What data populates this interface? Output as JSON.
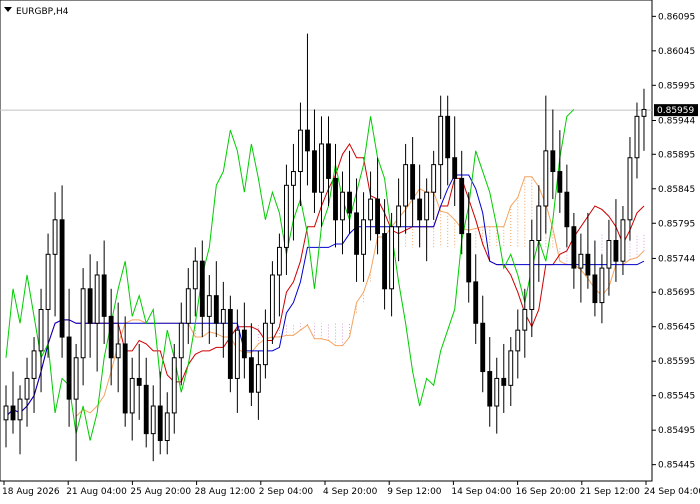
{
  "window": {
    "symbol_label": "EURGBP,H4"
  },
  "colors": {
    "background": "#ffffff",
    "candle": "#000000",
    "tenkan": "#cc0000",
    "kijun": "#0000cc",
    "chikou": "#00cc00",
    "span_a": "#f4a460",
    "span_b": "#d8a0d8",
    "current_price_line": "#c0c0c0",
    "price_tag_bg": "#000000"
  },
  "price_axis": {
    "ticks": [
      "0.86095",
      "0.86045",
      "0.85995",
      "0.85944",
      "0.85895",
      "0.85845",
      "0.85795",
      "0.85744",
      "0.85695",
      "0.85645",
      "0.85595",
      "0.85545",
      "0.85495",
      "0.85445"
    ],
    "current_price": "0.85959"
  },
  "time_axis": {
    "ticks": [
      "18 Aug 2026",
      "21 Aug 04:00",
      "25 Aug 20:00",
      "28 Aug 12:00",
      "2 Sep 04:00",
      "4 Sep 20:00",
      "9 Sep 12:00",
      "14 Sep 04:00",
      "16 Sep 20:00",
      "21 Sep 12:00",
      "24 Sep 04:00"
    ]
  },
  "chart_data": {
    "type": "candlestick",
    "title": "EURGBP,H4",
    "ylim": [
      0.8543,
      0.8611
    ],
    "candles": [
      [
        0.8551,
        0.8556,
        0.8547,
        0.8553
      ],
      [
        0.8553,
        0.8558,
        0.8549,
        0.8551
      ],
      [
        0.8551,
        0.8556,
        0.8546,
        0.8554
      ],
      [
        0.8554,
        0.856,
        0.855,
        0.8557
      ],
      [
        0.8557,
        0.8563,
        0.8552,
        0.8561
      ],
      [
        0.8561,
        0.857,
        0.8555,
        0.8567
      ],
      [
        0.8567,
        0.8578,
        0.856,
        0.8575
      ],
      [
        0.8575,
        0.8584,
        0.8566,
        0.858
      ],
      [
        0.858,
        0.8585,
        0.856,
        0.8563
      ],
      [
        0.8563,
        0.857,
        0.855,
        0.8554
      ],
      [
        0.8554,
        0.8562,
        0.8545,
        0.856
      ],
      [
        0.856,
        0.8573,
        0.8556,
        0.857
      ],
      [
        0.857,
        0.8575,
        0.856,
        0.8565
      ],
      [
        0.8565,
        0.8574,
        0.8558,
        0.8572
      ],
      [
        0.8572,
        0.8577,
        0.8562,
        0.8566
      ],
      [
        0.8566,
        0.857,
        0.8556,
        0.856
      ],
      [
        0.856,
        0.8568,
        0.8555,
        0.8562
      ],
      [
        0.8562,
        0.8566,
        0.855,
        0.8552
      ],
      [
        0.8552,
        0.856,
        0.8548,
        0.8557
      ],
      [
        0.8557,
        0.8562,
        0.8551,
        0.8556
      ],
      [
        0.8556,
        0.856,
        0.8547,
        0.8549
      ],
      [
        0.8549,
        0.8556,
        0.8545,
        0.8553
      ],
      [
        0.8553,
        0.8558,
        0.8546,
        0.8548
      ],
      [
        0.8548,
        0.8555,
        0.8546,
        0.8552
      ],
      [
        0.8552,
        0.8562,
        0.8549,
        0.856
      ],
      [
        0.856,
        0.8568,
        0.8556,
        0.8565
      ],
      [
        0.8565,
        0.8573,
        0.8562,
        0.857
      ],
      [
        0.857,
        0.8576,
        0.8566,
        0.8574
      ],
      [
        0.8574,
        0.8577,
        0.8563,
        0.8566
      ],
      [
        0.8566,
        0.8572,
        0.8562,
        0.8569
      ],
      [
        0.8569,
        0.8574,
        0.8563,
        0.8565
      ],
      [
        0.8565,
        0.8571,
        0.856,
        0.8567
      ],
      [
        0.8567,
        0.8569,
        0.8555,
        0.8557
      ],
      [
        0.8557,
        0.8567,
        0.8552,
        0.8564
      ],
      [
        0.8564,
        0.8568,
        0.8557,
        0.856
      ],
      [
        0.856,
        0.8565,
        0.8553,
        0.8555
      ],
      [
        0.8555,
        0.8561,
        0.8551,
        0.8559
      ],
      [
        0.8559,
        0.8567,
        0.8557,
        0.8565
      ],
      [
        0.8565,
        0.8574,
        0.8562,
        0.8572
      ],
      [
        0.8572,
        0.8578,
        0.8566,
        0.8576
      ],
      [
        0.8576,
        0.8588,
        0.8572,
        0.8585
      ],
      [
        0.8585,
        0.8591,
        0.8577,
        0.8587
      ],
      [
        0.8587,
        0.8597,
        0.8582,
        0.8593
      ],
      [
        0.8593,
        0.8607,
        0.8585,
        0.859
      ],
      [
        0.859,
        0.8596,
        0.8581,
        0.8584
      ],
      [
        0.8584,
        0.8595,
        0.8579,
        0.8591
      ],
      [
        0.8591,
        0.8595,
        0.8582,
        0.8586
      ],
      [
        0.8586,
        0.8591,
        0.8576,
        0.858
      ],
      [
        0.858,
        0.8587,
        0.8575,
        0.8584
      ],
      [
        0.8584,
        0.859,
        0.8578,
        0.8581
      ],
      [
        0.8581,
        0.8586,
        0.8571,
        0.8575
      ],
      [
        0.8575,
        0.8584,
        0.8571,
        0.858
      ],
      [
        0.858,
        0.8587,
        0.8577,
        0.8583
      ],
      [
        0.8583,
        0.8589,
        0.8575,
        0.8578
      ],
      [
        0.8578,
        0.8583,
        0.8567,
        0.857
      ],
      [
        0.857,
        0.8581,
        0.8566,
        0.8579
      ],
      [
        0.8579,
        0.8586,
        0.8574,
        0.8582
      ],
      [
        0.8582,
        0.8591,
        0.8578,
        0.8588
      ],
      [
        0.8588,
        0.8592,
        0.8579,
        0.8583
      ],
      [
        0.8583,
        0.8588,
        0.8576,
        0.858
      ],
      [
        0.858,
        0.8586,
        0.8574,
        0.8584
      ],
      [
        0.8584,
        0.859,
        0.858,
        0.8588
      ],
      [
        0.8588,
        0.8598,
        0.8583,
        0.8595
      ],
      [
        0.8595,
        0.8598,
        0.8585,
        0.8589
      ],
      [
        0.8589,
        0.8595,
        0.8582,
        0.8586
      ],
      [
        0.8586,
        0.859,
        0.8575,
        0.8578
      ],
      [
        0.8578,
        0.8584,
        0.8568,
        0.8571
      ],
      [
        0.8571,
        0.8575,
        0.8562,
        0.8565
      ],
      [
        0.8565,
        0.8569,
        0.8555,
        0.8558
      ],
      [
        0.8558,
        0.8563,
        0.855,
        0.8553
      ],
      [
        0.8553,
        0.856,
        0.8549,
        0.8557
      ],
      [
        0.8557,
        0.8562,
        0.8552,
        0.8556
      ],
      [
        0.8556,
        0.8563,
        0.8553,
        0.8561
      ],
      [
        0.8561,
        0.8567,
        0.8557,
        0.8564
      ],
      [
        0.8564,
        0.857,
        0.856,
        0.8567
      ],
      [
        0.8567,
        0.858,
        0.8563,
        0.8577
      ],
      [
        0.8577,
        0.8585,
        0.8571,
        0.8582
      ],
      [
        0.8582,
        0.8598,
        0.8578,
        0.859
      ],
      [
        0.859,
        0.8596,
        0.8583,
        0.8587
      ],
      [
        0.8587,
        0.8593,
        0.8581,
        0.8584
      ],
      [
        0.8584,
        0.8588,
        0.8576,
        0.8579
      ],
      [
        0.8579,
        0.8581,
        0.857,
        0.8573
      ],
      [
        0.8573,
        0.8578,
        0.8568,
        0.8575
      ],
      [
        0.8575,
        0.8581,
        0.857,
        0.8572
      ],
      [
        0.8572,
        0.8577,
        0.8566,
        0.8568
      ],
      [
        0.8568,
        0.8575,
        0.8565,
        0.8573
      ],
      [
        0.8573,
        0.858,
        0.8569,
        0.8577
      ],
      [
        0.8577,
        0.8583,
        0.8571,
        0.8574
      ],
      [
        0.8574,
        0.8582,
        0.8572,
        0.858
      ],
      [
        0.858,
        0.8592,
        0.8577,
        0.8589
      ],
      [
        0.8589,
        0.8597,
        0.8586,
        0.8595
      ],
      [
        0.8595,
        0.8599,
        0.859,
        0.8596
      ]
    ]
  }
}
